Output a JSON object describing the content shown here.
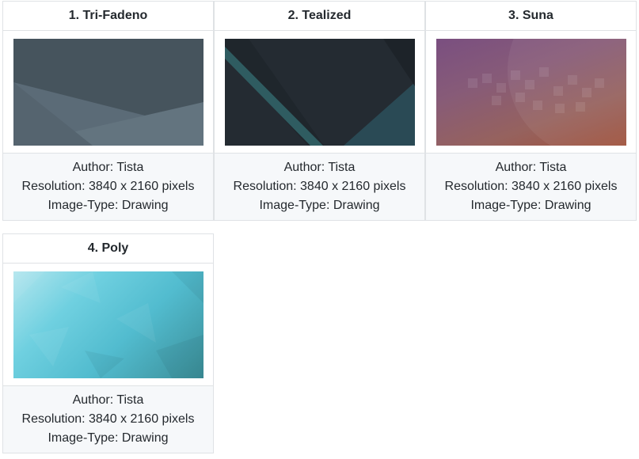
{
  "wallpapers": [
    {
      "title": "1. Tri-Fadeno",
      "author": "Author: Tista",
      "resolution": "Resolution: 3840 x 2160 pixels",
      "image_type": "Image-Type: Drawing"
    },
    {
      "title": "2. Tealized",
      "author": "Author: Tista",
      "resolution": "Resolution: 3840 x 2160 pixels",
      "image_type": "Image-Type: Drawing"
    },
    {
      "title": "3. Suna",
      "author": "Author: Tista",
      "resolution": "Resolution: 3840 x 2160 pixels",
      "image_type": "Image-Type: Drawing"
    },
    {
      "title": "4. Poly",
      "author": "Author: Tista",
      "resolution": "Resolution: 3840 x 2160 pixels",
      "image_type": "Image-Type: Drawing"
    }
  ],
  "colors": {
    "border": "#dfe2e5",
    "meta_bg": "#f6f8fa",
    "text": "#24292e"
  }
}
